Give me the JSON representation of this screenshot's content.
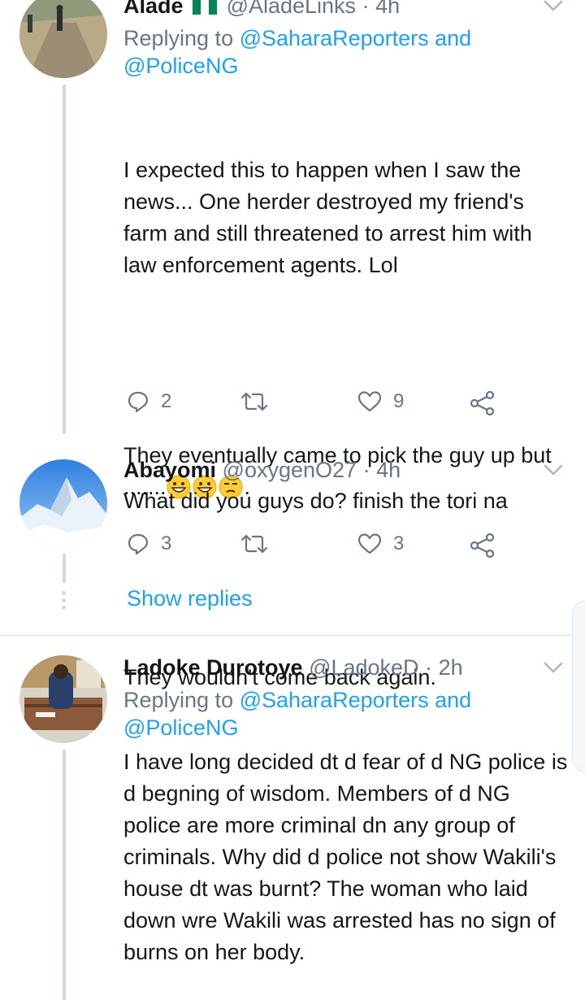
{
  "tweets": [
    {
      "name": "Alade",
      "flag": "🇳🇬",
      "handle": "@AladeLinks",
      "time": "· 4h",
      "replying_prefix": "Replying to ",
      "replying_to_1": "@SaharaReporters and",
      "replying_to_2": "@PoliceNG",
      "text_1": "I expected this to happen when I saw the news... One herder destroyed my friend's farm and still threatened to arrest him with law enforcement agents. Lol",
      "text_2_prefix": "They eventually came to pick the guy up but .......",
      "text_2_suffix": ".",
      "text_3": "They wouldn't come back again.",
      "replies": "2",
      "retweets": "",
      "likes": "9"
    },
    {
      "name": "Abayomi",
      "handle": "@oxygenO27",
      "time": "· 4h",
      "text": "What did you guys do? finish the tori na",
      "replies": "3",
      "retweets": "",
      "likes": "3"
    },
    {
      "name": "Ladoke Durotoye",
      "handle": "@LadokeD",
      "time": "· 2h",
      "replying_prefix": "Replying to ",
      "replying_to_1": "@SaharaReporters and",
      "replying_to_2": "@PoliceNG",
      "text": "I have long decided dt d fear of d NG police is d begning of wisdom. Members of d NG police are more criminal dn any group of criminals. Why did d police not show Wakili's house dt was burnt? The woman who laid down wre Wakili was arrested has no sign of burns on her body."
    }
  ],
  "show_replies": "Show replies",
  "icons": {
    "reply": "reply-icon",
    "retweet": "retweet-icon",
    "like": "heart-icon",
    "share": "share-icon",
    "caret": "chevron-down-icon"
  },
  "colors": {
    "link": "#1da1f2",
    "muted": "#657786",
    "text": "#14171a"
  }
}
